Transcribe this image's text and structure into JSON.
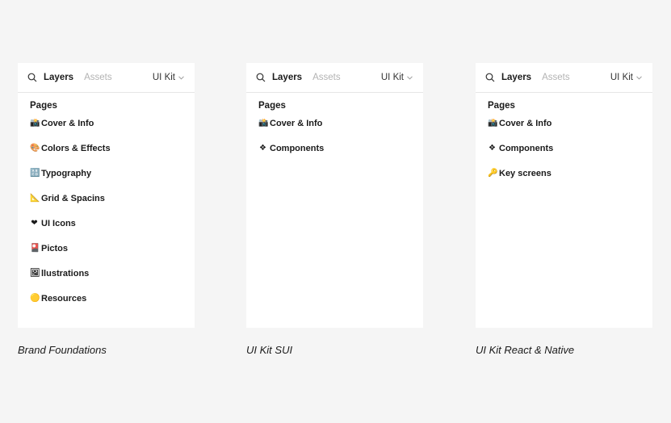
{
  "panels": [
    {
      "layers_tab": "Layers",
      "assets_tab": "Assets",
      "kit_label": "UI Kit",
      "pages_header": "Pages",
      "items": [
        {
          "emoji": "📸",
          "label": "Cover & Info"
        },
        {
          "emoji": "🎨",
          "label": "Colors & Effects"
        },
        {
          "emoji": "🔠",
          "label": "Typography"
        },
        {
          "emoji": "📐",
          "label": "Grid & Spacins"
        },
        {
          "emoji": "❤",
          "label": "UI Icons"
        },
        {
          "emoji": "🎴",
          "label": "Pictos"
        },
        {
          "emoji": "🖼",
          "label": "llustrations"
        },
        {
          "emoji": "🟡",
          "label": "Resources"
        }
      ],
      "caption": "Brand Foundations"
    },
    {
      "layers_tab": "Layers",
      "assets_tab": "Assets",
      "kit_label": "UI Kit",
      "pages_header": "Pages",
      "items": [
        {
          "emoji": "📸",
          "label": "Cover & Info"
        },
        {
          "emoji": "❖",
          "label": "Components"
        }
      ],
      "caption": "UI Kit SUI"
    },
    {
      "layers_tab": "Layers",
      "assets_tab": "Assets",
      "kit_label": "UI Kit",
      "pages_header": "Pages",
      "items": [
        {
          "emoji": "📸",
          "label": "Cover & Info"
        },
        {
          "emoji": "❖",
          "label": "Components"
        },
        {
          "emoji": "🔑",
          "label": "Key screens"
        }
      ],
      "caption": "UI Kit React & Native"
    }
  ]
}
